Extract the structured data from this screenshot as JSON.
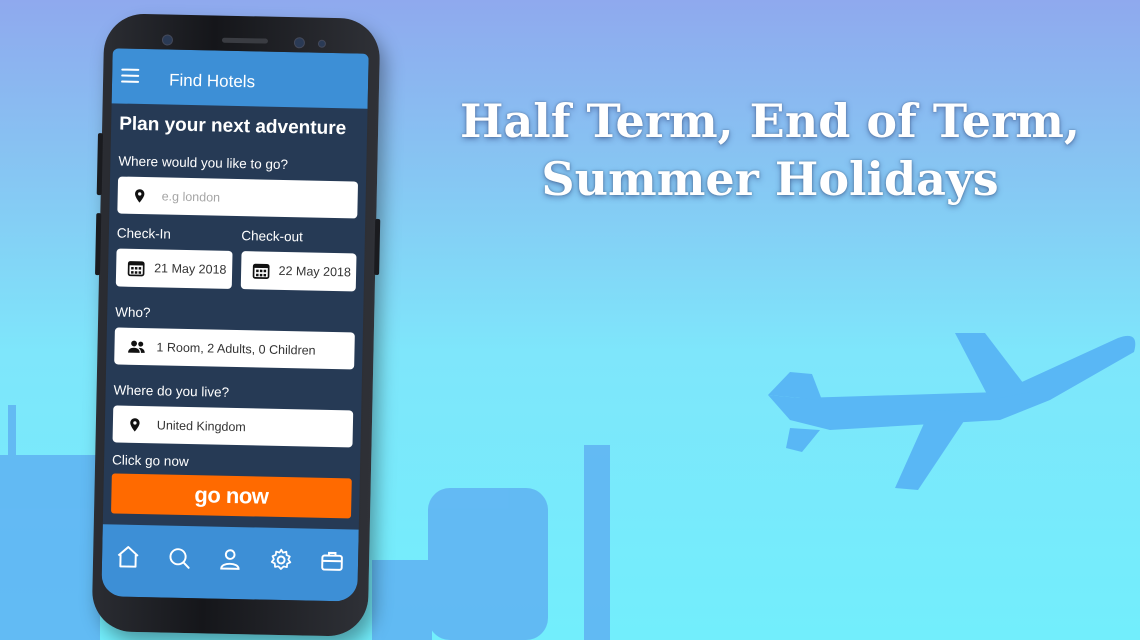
{
  "headline": {
    "line1": "Half Term, End of Term,",
    "line2": "Summer Holidays"
  },
  "app": {
    "title": "Find Hotels",
    "heading": "Plan your next adventure",
    "destination": {
      "label": "Where would you like to go?",
      "placeholder": "e.g london",
      "icon": "location-pin-icon"
    },
    "checkin": {
      "label": "Check-In",
      "value": "21 May 2018",
      "icon": "calendar-icon"
    },
    "checkout": {
      "label": "Check-out",
      "value": "22 May 2018",
      "icon": "calendar-icon"
    },
    "who": {
      "label": "Who?",
      "value": "1 Room, 2 Adults, 0 Children",
      "icon": "people-icon"
    },
    "residence": {
      "label": "Where do you live?",
      "value": "United Kingdom",
      "icon": "location-pin-icon"
    },
    "go": {
      "label": "Click go now",
      "button": "go now"
    },
    "tabs": [
      "home-icon",
      "search-icon",
      "profile-icon",
      "settings-icon",
      "briefcase-icon"
    ]
  },
  "colors": {
    "appbar": "#3d8fd6",
    "panel": "#263a55",
    "cta": "#ff6a00"
  }
}
